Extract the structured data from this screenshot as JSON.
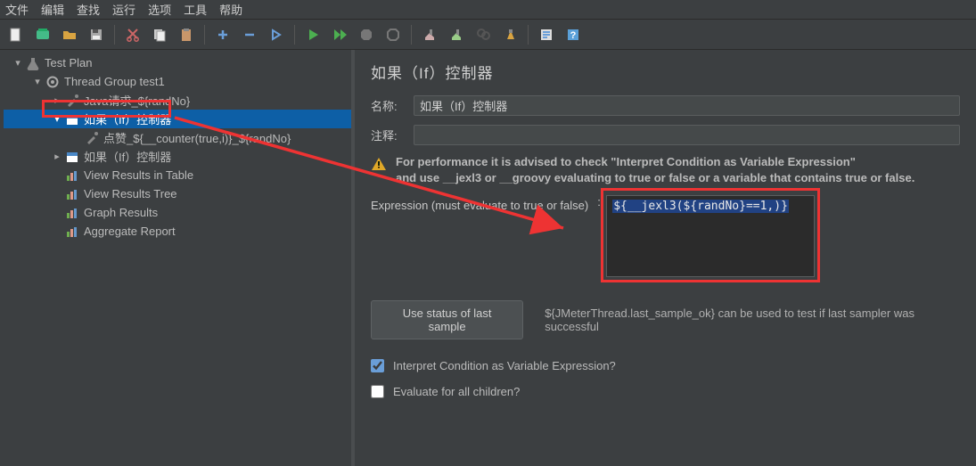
{
  "menu": {
    "file": "文件",
    "edit": "编辑",
    "search": "查找",
    "run": "运行",
    "options": "选项",
    "tools": "工具",
    "help": "帮助"
  },
  "tree": {
    "root": "Test Plan",
    "thread_group": "Thread Group test1",
    "java_req": "Java请求_${randNo}",
    "if1": "如果（If）控制器",
    "like_req": "点赞_${__counter(true,i)}_${randNo}",
    "if2": "如果（If）控制器",
    "vrt": "View Results in Table",
    "vrtree": "View Results Tree",
    "graph": "Graph Results",
    "agg": "Aggregate Report"
  },
  "panel": {
    "title": "如果（If）控制器",
    "name_label": "名称:",
    "name_value": "如果（If）控制器",
    "comment_label": "注释:",
    "comment_value": "",
    "warn_line1": "For performance it is advised to check \"Interpret Condition as Variable Expression\"",
    "warn_line2": "and use __jexl3 or __groovy evaluating to true or false or a variable that contains true or false.",
    "expr_label": "Expression (must evaluate to true or false)",
    "expr_value": "${__jexl3(${randNo}==1,)}",
    "btn_last": "Use status of last sample",
    "hint_last": "${JMeterThread.last_sample_ok} can be used to test if last sampler was successful",
    "chk_interpret": "Interpret Condition as Variable Expression?",
    "chk_children": "Evaluate for all children?"
  }
}
